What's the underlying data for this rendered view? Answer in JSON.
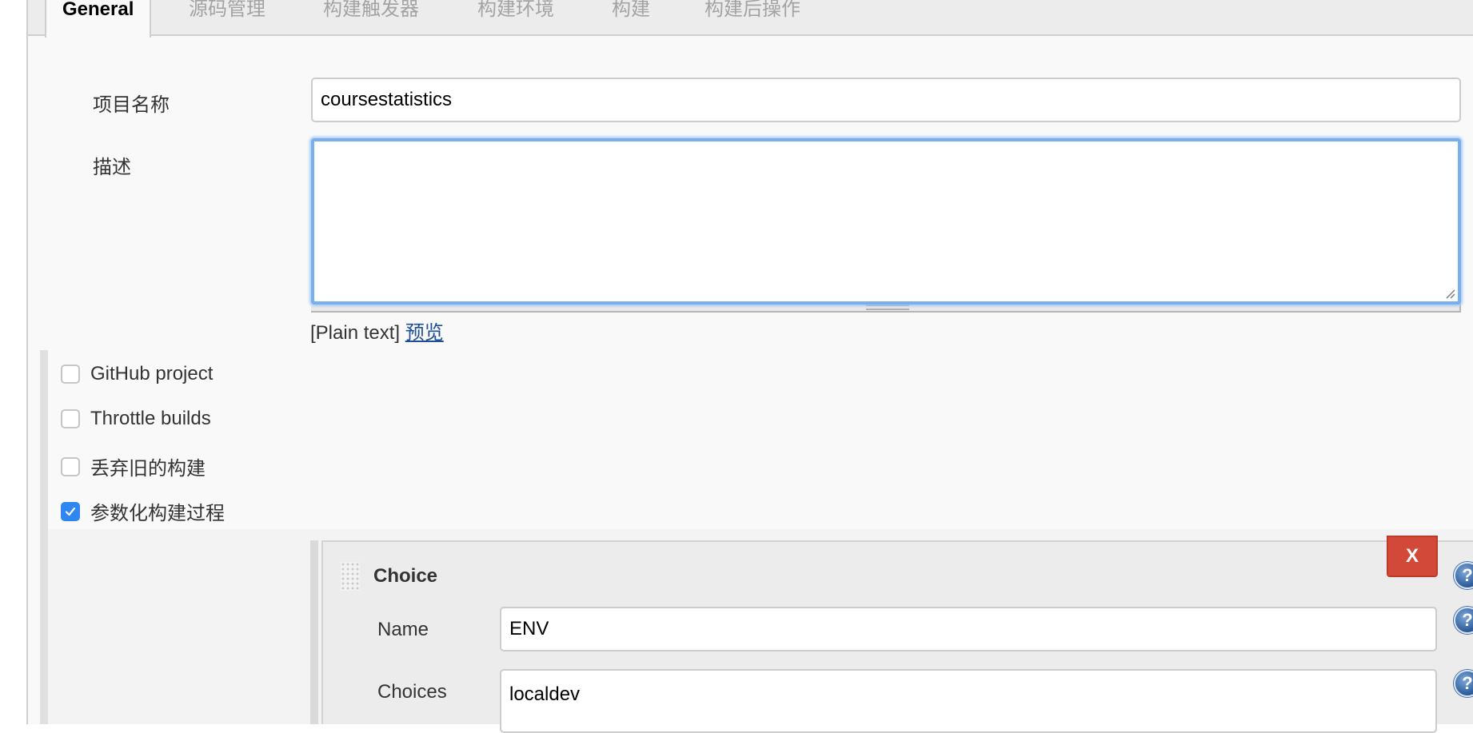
{
  "tabs": [
    {
      "label": "General",
      "active": true
    },
    {
      "label": "源码管理",
      "active": false
    },
    {
      "label": "构建触发器",
      "active": false
    },
    {
      "label": "构建环境",
      "active": false
    },
    {
      "label": "构建",
      "active": false
    },
    {
      "label": "构建后操作",
      "active": false
    }
  ],
  "general": {
    "project_name_label": "项目名称",
    "project_name_value": "coursestatistics",
    "description_label": "描述",
    "description_value": "",
    "markup_note": "[Plain text]",
    "preview_link": "预览"
  },
  "options": [
    {
      "label": "GitHub project",
      "checked": false
    },
    {
      "label": "Throttle builds",
      "checked": false
    },
    {
      "label": "丢弃旧的构建",
      "checked": false
    },
    {
      "label": "参数化构建过程",
      "checked": true
    }
  ],
  "parameter": {
    "title": "Choice",
    "delete_label": "X",
    "name_label": "Name",
    "name_value": "ENV",
    "choices_label": "Choices",
    "choices_value": "localdev",
    "help_icon": "?"
  },
  "colors": {
    "delete_button": "#d24939",
    "focus_ring": "#78b0ef",
    "checkbox_checked": "#2f86f0",
    "link": "#1f4f96"
  }
}
